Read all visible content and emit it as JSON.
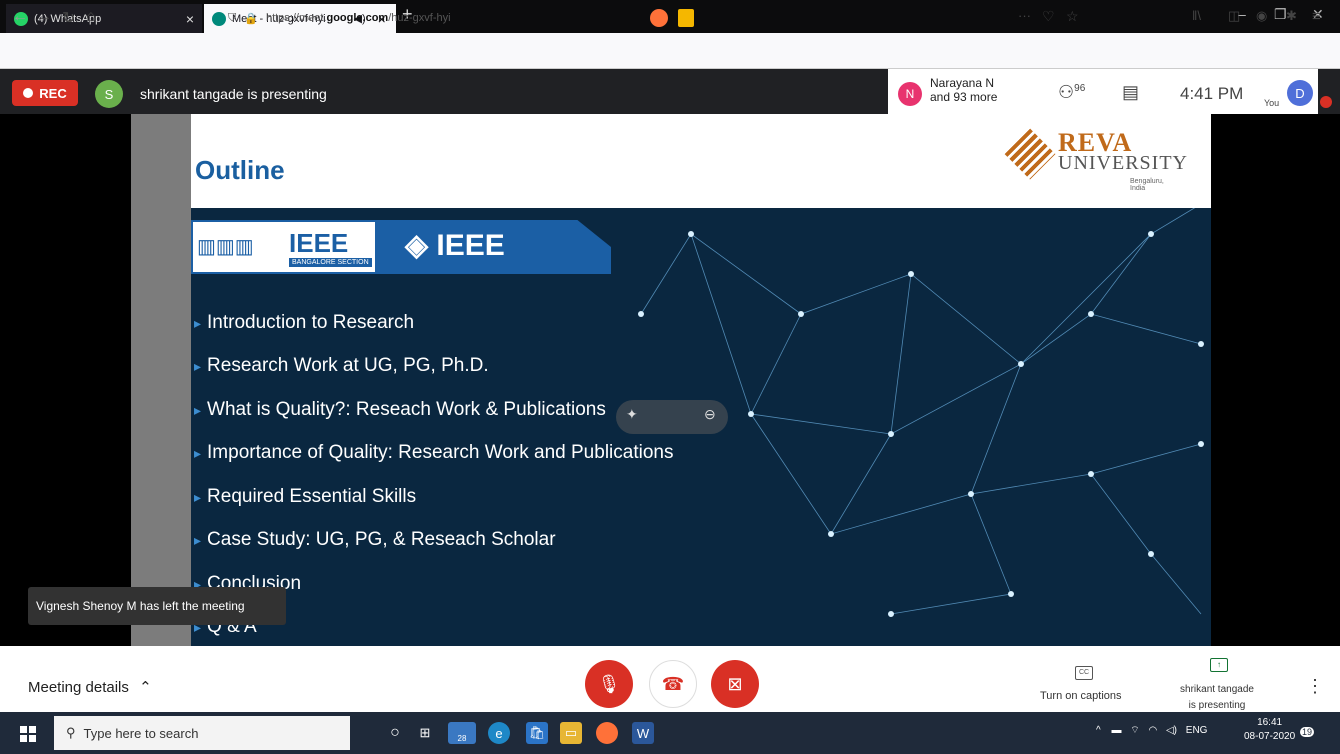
{
  "browser": {
    "tabs": [
      {
        "label": "(4) WhatsApp",
        "close": "×"
      },
      {
        "label": "Meet - huz-gxvf-hyi",
        "close": "×"
      }
    ],
    "new_tab": "+",
    "url_prefix": "https://meet.",
    "url_host": "google.com",
    "url_path": "/huz-gxvf-hyi"
  },
  "meet": {
    "rec_label": "REC",
    "presenter_initial": "S",
    "presenting_text": "shrikant tangade is presenting",
    "participant_initial": "N",
    "participant_line1": "Narayana N",
    "participant_line2": "and 93 more",
    "people_count": "96",
    "time": "4:41 PM",
    "you_label": "You",
    "self_initial": "D"
  },
  "slide": {
    "title": "Outline",
    "logo_name": "REVA",
    "logo_uni": "UNIVERSITY",
    "logo_loc": "Bengaluru, India",
    "ieee_left": "IEEE",
    "ieee_section": "BANGALORE SECTION",
    "ieee_right": "IEEE",
    "bullets": [
      "Introduction to Research",
      "Research Work at UG, PG, Ph.D.",
      "What is Quality?: Reseach Work & Publications",
      "Importance of Quality: Research Work and Publications",
      "Required Essential Skills",
      "Case Study: UG, PG, & Reseach Scholar",
      "Conclusion",
      "Q & A"
    ]
  },
  "toast": "Vignesh Shenoy M has left the meeting",
  "controls": {
    "meeting_details": "Meeting details",
    "captions_label": "Turn on captions",
    "captions_icon": "CC",
    "presenting_line1": "shrikant tangade",
    "presenting_line2": "is presenting"
  },
  "taskbar": {
    "search_placeholder": "Type here to search",
    "store_badge": "28",
    "lang": "ENG",
    "clock_time": "16:41",
    "clock_date": "08-07-2020",
    "notif_count": "19"
  }
}
